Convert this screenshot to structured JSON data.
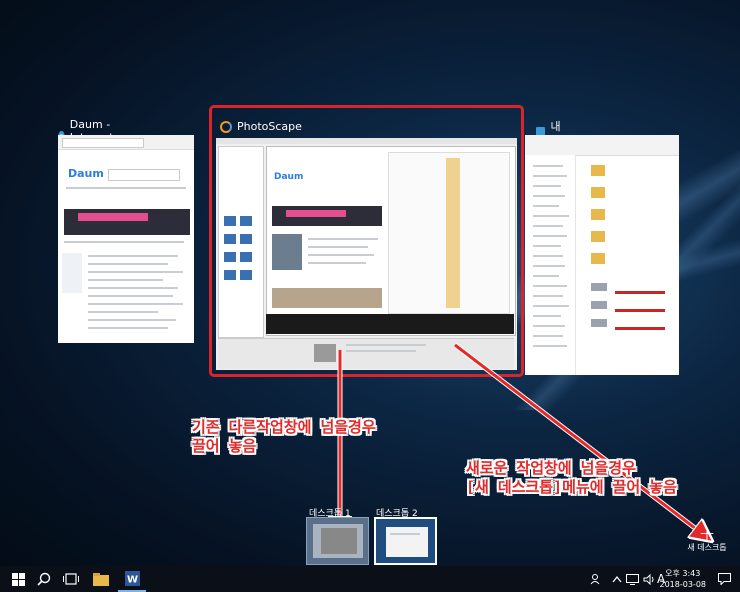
{
  "windows": {
    "ie": {
      "title": "Daum - Internet Explorer",
      "logo": "Daum",
      "icon": "internet-explorer-icon"
    },
    "photoscape": {
      "title": "PhotoScape",
      "icon": "photoscape-icon"
    },
    "explorer": {
      "title": "내 PC",
      "icon": "this-pc-icon"
    }
  },
  "annotations": {
    "existing_line1": "기존 다른작업창에 넘을경우",
    "existing_line2": "끌어 놓음",
    "new_line1": "새로운 작업창에 넘을경우",
    "new_line2": "[새 데스크톱]메뉴에 끌어 놓음"
  },
  "desktops": [
    {
      "label": "데스크톱 1"
    },
    {
      "label": "데스크톱 2"
    }
  ],
  "new_desktop": {
    "label": "새 데스크톱",
    "plus": "+"
  },
  "taskbar": {
    "clock_time": "오후 3:43",
    "clock_date": "2018-03-08",
    "ime": "A"
  },
  "colors": {
    "highlight": "#d9252a",
    "annotation": "#e32a2a"
  }
}
